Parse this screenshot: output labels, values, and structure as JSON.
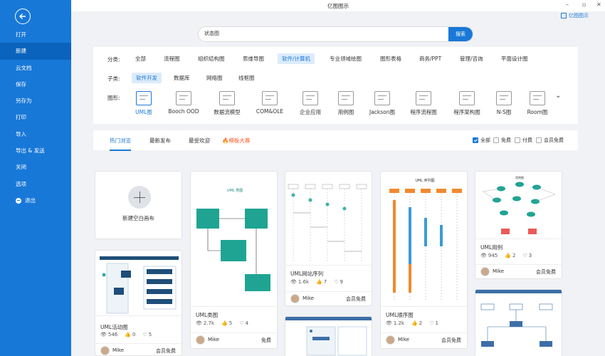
{
  "app": {
    "title": "亿图图示",
    "user": "亿图图示"
  },
  "sidebar": {
    "items": [
      {
        "label": "打开"
      },
      {
        "label": "新建"
      },
      {
        "label": "云文档"
      },
      {
        "label": "保存"
      },
      {
        "label": "另存为"
      },
      {
        "label": "打印"
      },
      {
        "label": "导入"
      },
      {
        "label": "导出 & 发送"
      },
      {
        "label": "关闭"
      },
      {
        "label": "选项"
      },
      {
        "label": "退出"
      }
    ]
  },
  "search": {
    "value": "状态图",
    "button": "搜索"
  },
  "filter": {
    "category_label": "分类:",
    "categories": [
      "全部",
      "流程图",
      "组织结构图",
      "思维导图",
      "软件/计算机",
      "专业领域绘图",
      "图形表格",
      "商务/PPT",
      "管理/咨询",
      "平面设计图"
    ],
    "subcategory_label": "子类:",
    "subcategories": [
      "软件开发",
      "数据库",
      "网络图",
      "线框图"
    ],
    "shape_label": "图形:",
    "shapes": [
      "UML图",
      "Booch OOD",
      "数据流模型",
      "COM&OLE",
      "企业应用",
      "用例图",
      "Jackson图",
      "程序流程图",
      "程序架构图",
      "N-S图",
      "Room图"
    ]
  },
  "tabs": [
    "热门浏览",
    "最新发布",
    "最受欢迎",
    "模板大赛"
  ],
  "options": [
    "全部",
    "免费",
    "付费",
    "会员免费"
  ],
  "blank": {
    "label": "新建空白画布"
  },
  "cards": [
    {
      "title": "UML活动图",
      "views": "546",
      "likes": "0",
      "favs": "5",
      "author": "Mike",
      "price": "会员免费"
    },
    {
      "title": "UML类图",
      "thumb_title": "UML 类图",
      "views": "2.7k",
      "likes": "5",
      "favs": "4",
      "author": "Mike",
      "price": "免费"
    },
    {
      "title": "UML网站序列",
      "views": "1.6k",
      "likes": "7",
      "favs": "9",
      "author": "Mike",
      "price": "会员免费"
    },
    {
      "title": "UML顺序图",
      "thumb_title": "UML 序列图",
      "views": "1.2k",
      "likes": "2",
      "favs": "1",
      "author": "Mike",
      "price": "会员免费"
    },
    {
      "title": "UML用例",
      "thumb_title": "用例图",
      "views": "945",
      "likes": "2",
      "favs": "3",
      "author": "Mike",
      "price": "会员免费"
    }
  ]
}
